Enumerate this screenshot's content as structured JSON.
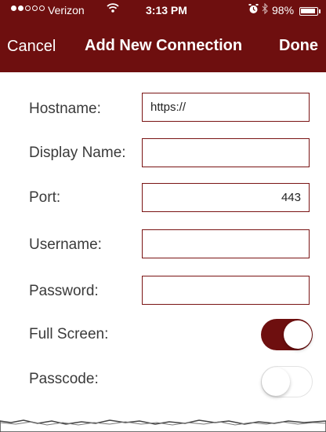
{
  "status_bar": {
    "carrier": "Verizon",
    "time": "3:13 PM",
    "battery_percent": "98%",
    "battery_level": 0.98,
    "signal_bars": 2,
    "signal_total": 5,
    "wifi_icon": "wifi-icon",
    "alarm_icon": "alarm-icon",
    "bluetooth_icon": "bluetooth-icon"
  },
  "nav": {
    "cancel_label": "Cancel",
    "title": "Add New Connection",
    "done_label": "Done"
  },
  "form": {
    "hostname": {
      "label": "Hostname:",
      "value": "https://"
    },
    "display_name": {
      "label": "Display Name:",
      "value": ""
    },
    "port": {
      "label": "Port:",
      "value": "443"
    },
    "username": {
      "label": "Username:",
      "value": ""
    },
    "password": {
      "label": "Password:",
      "value": ""
    },
    "full_screen": {
      "label": "Full Screen:",
      "on": true
    },
    "passcode": {
      "label": "Passcode:",
      "on": false
    }
  },
  "colors": {
    "accent": "#6e0f0f",
    "field_border": "#7a1414",
    "label_text": "#3a3a3a"
  }
}
